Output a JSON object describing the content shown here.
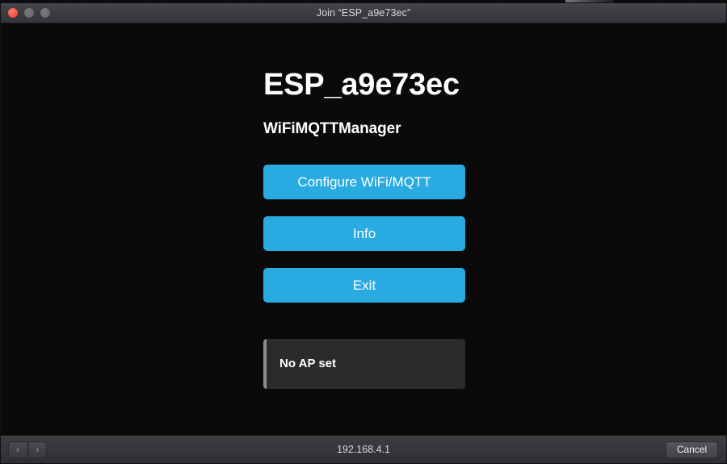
{
  "window": {
    "title": "Join “ESP_a9e73ec”",
    "traffic_lights": [
      {
        "name": "close",
        "label": "Close"
      },
      {
        "name": "minimize",
        "label": "Minimize"
      },
      {
        "name": "zoom",
        "label": "Zoom"
      }
    ]
  },
  "page": {
    "device_name": "ESP_a9e73ec",
    "app_name": "WiFiMQTTManager",
    "buttons": [
      {
        "id": "configure",
        "label": "Configure WiFi/MQTT"
      },
      {
        "id": "info",
        "label": "Info"
      },
      {
        "id": "exit",
        "label": "Exit"
      }
    ],
    "status_message": "No AP set"
  },
  "toolbar": {
    "back_icon": "‹",
    "forward_icon": "›",
    "url": "192.168.4.1",
    "cancel_label": "Cancel"
  },
  "colors": {
    "accent_blue": "#29abe2",
    "page_background": "#0a0a0a",
    "message_box_background": "#2b2b2b",
    "message_box_border": "#8c8c8c",
    "chrome": "#3b3c40"
  }
}
